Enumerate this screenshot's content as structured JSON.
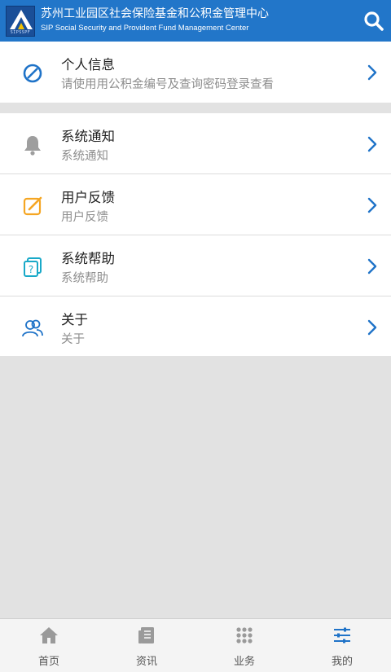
{
  "header": {
    "logo_text": "SIPSSPF",
    "title_cn": "苏州工业园区社会保险基金和公积金管理中心",
    "title_en": "SIP Social Security and Provident Fund Management Center"
  },
  "personal": {
    "title": "个人信息",
    "subtitle": "请使用用公积金编号及查询密码登录查看",
    "icon": "block-icon"
  },
  "menu": [
    {
      "title": "系统通知",
      "subtitle": "系统通知",
      "icon": "bell-icon"
    },
    {
      "title": "用户反馈",
      "subtitle": "用户反馈",
      "icon": "edit-icon"
    },
    {
      "title": "系统帮助",
      "subtitle": "系统帮助",
      "icon": "help-icon"
    },
    {
      "title": "关于",
      "subtitle": "关于",
      "icon": "users-icon"
    }
  ],
  "tabs": [
    {
      "label": "首页",
      "icon": "home-icon"
    },
    {
      "label": "资讯",
      "icon": "news-icon"
    },
    {
      "label": "业务",
      "icon": "grid-icon"
    },
    {
      "label": "我的",
      "icon": "settings-sliders-icon"
    }
  ],
  "colors": {
    "header_bg": "#2276c9",
    "accent_blue": "#1f73c8",
    "edit_orange": "#f5a623",
    "help_cyan": "#19a9c8",
    "bell_gray": "#9e9e9e"
  }
}
